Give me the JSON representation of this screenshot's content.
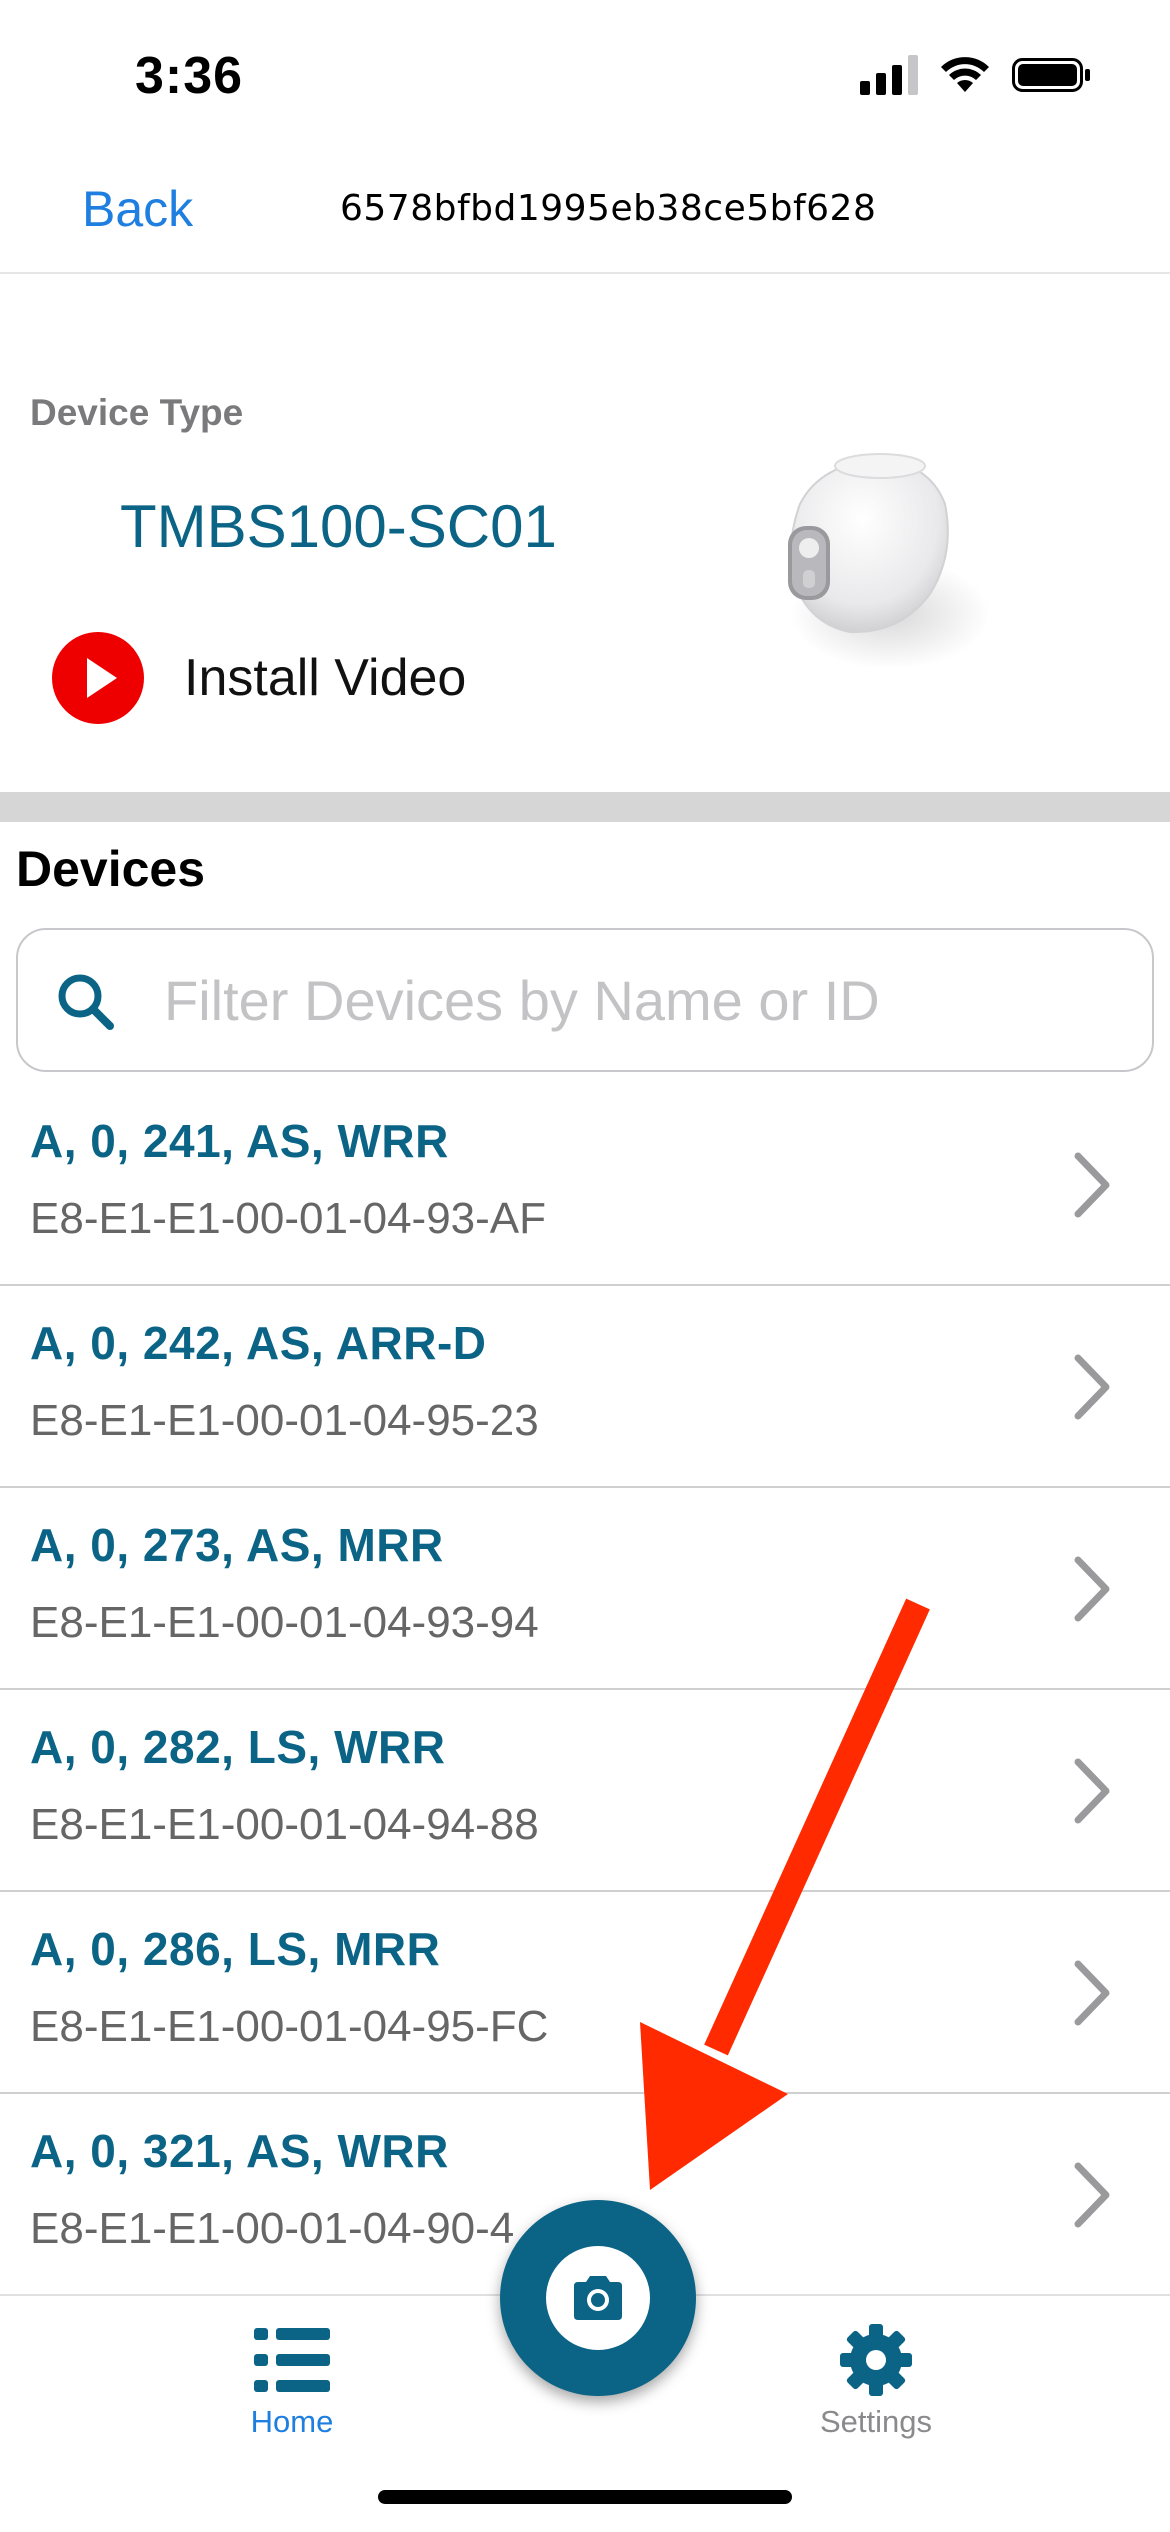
{
  "status_bar": {
    "time": "3:36"
  },
  "nav": {
    "back_label": "Back",
    "title": "6578bfbd1995eb38ce5bf628"
  },
  "device_type": {
    "label": "Device Type",
    "model": "TMBS100-SC01",
    "install_video_label": "Install Video",
    "image_icon": "motion-sensor-image"
  },
  "devices": {
    "title": "Devices",
    "search_placeholder": "Filter Devices by Name or ID",
    "search_value": "",
    "items": [
      {
        "name": "A, 0, 241, AS, WRR",
        "id": "E8-E1-E1-00-01-04-93-AF"
      },
      {
        "name": "A, 0, 242, AS, ARR-D",
        "id": "E8-E1-E1-00-01-04-95-23"
      },
      {
        "name": "A, 0, 273, AS, MRR",
        "id": "E8-E1-E1-00-01-04-93-94"
      },
      {
        "name": "A, 0, 282, LS, WRR",
        "id": "E8-E1-E1-00-01-04-94-88"
      },
      {
        "name": "A, 0, 286, LS, MRR",
        "id": "E8-E1-E1-00-01-04-95-FC"
      },
      {
        "name": "A, 0, 321, AS, WRR",
        "id": "E8-E1-E1-00-01-04-90-4"
      }
    ]
  },
  "tab_bar": {
    "home_label": "Home",
    "settings_label": "Settings",
    "camera_icon": "camera-icon"
  },
  "colors": {
    "accent_blue": "#1e7fe0",
    "brand_teal": "#0b6486",
    "play_red": "#ee0000",
    "annotation_arrow": "#ff2a00"
  }
}
